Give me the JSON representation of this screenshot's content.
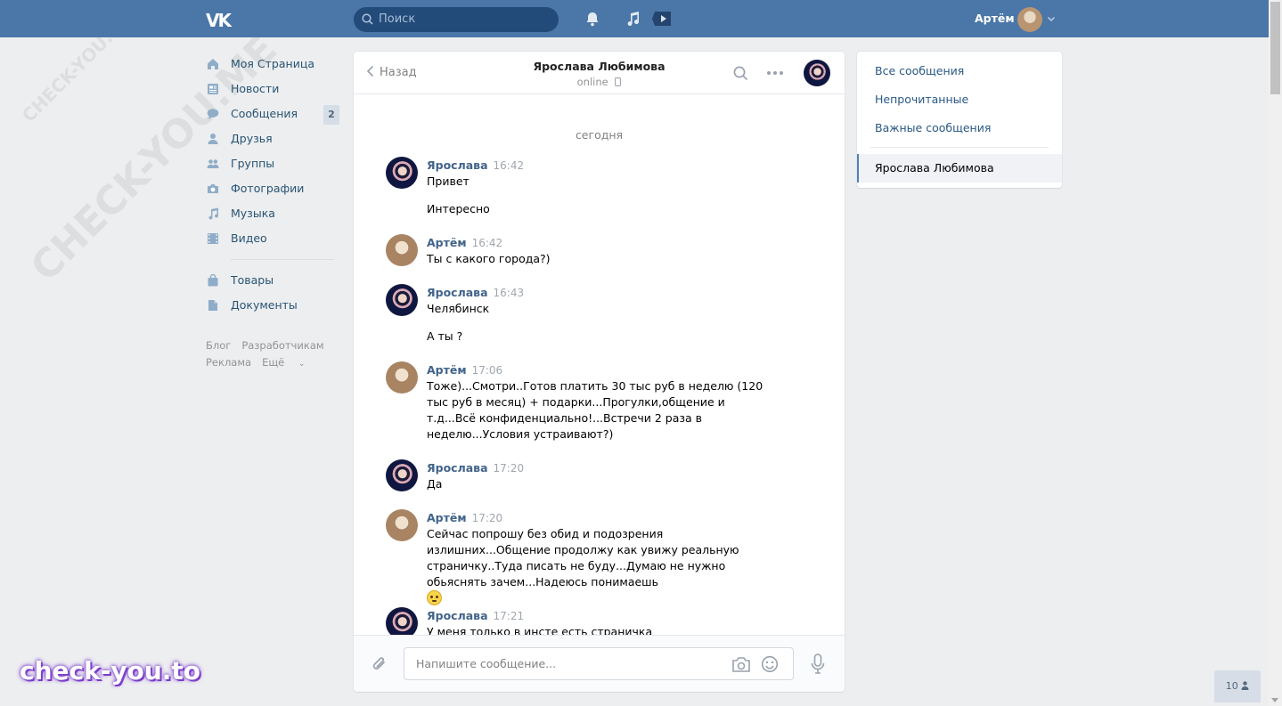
{
  "header": {
    "logo": "VK",
    "search_placeholder": "Поиск",
    "user_name": "Артём"
  },
  "nav": {
    "items": [
      {
        "label": "Моя Страница",
        "icon": "home-icon"
      },
      {
        "label": "Новости",
        "icon": "news-icon"
      },
      {
        "label": "Сообщения",
        "icon": "messages-icon",
        "badge": "2"
      },
      {
        "label": "Друзья",
        "icon": "friends-icon"
      },
      {
        "label": "Группы",
        "icon": "groups-icon"
      },
      {
        "label": "Фотографии",
        "icon": "camera-icon"
      },
      {
        "label": "Музыка",
        "icon": "music-icon"
      },
      {
        "label": "Видео",
        "icon": "video-icon"
      }
    ],
    "items2": [
      {
        "label": "Товары",
        "icon": "bag-icon"
      },
      {
        "label": "Документы",
        "icon": "document-icon"
      }
    ],
    "footer": {
      "blog": "Блог",
      "developers": "Разработчикам",
      "ads": "Реклама",
      "more": "Ещё"
    }
  },
  "chat": {
    "back_label": "Назад",
    "peer_name": "Ярослава Любимова",
    "peer_status": "online",
    "day_separator": "сегодня",
    "messages": [
      {
        "author": "Ярослава",
        "time": "16:42",
        "text": "Привет",
        "text2": "Интересно"
      },
      {
        "author": "Артём",
        "time": "16:42",
        "text": "Ты с какого города?)"
      },
      {
        "author": "Ярослава",
        "time": "16:43",
        "text": "Челябинск",
        "text2": "А ты ?"
      },
      {
        "author": "Артём",
        "time": "17:06",
        "text": "Тоже)...Смотри..Готов платить 30 тыс руб в неделю (120 тыс руб в месяц) + подарки...Прогулки,общение и т.д...Всё конфиденциально!...Встречи 2 раза в неделю...Условия устраивают?)"
      },
      {
        "author": "Ярослава",
        "time": "17:20",
        "text": "Да"
      },
      {
        "author": "Артём",
        "time": "17:20",
        "text": "Сейчас попрошу без обид и подозрения излишних...Общение продолжу как увижу реальную страничку..Туда писать не буду...Думаю не нужно обьяснять зачем...Надеюсь понимаешь"
      },
      {
        "author": "Ярослава",
        "time": "17:21",
        "text": "У меня только в инсте есть страничка"
      }
    ],
    "input_placeholder": "Напишите сообщение..."
  },
  "right_panel": {
    "all": "Все сообщения",
    "unread": "Непрочитанные",
    "important": "Важные сообщения",
    "active_conversation": "Ярослава Любимова"
  },
  "watermark": {
    "brand": "check-you.to",
    "diagonal": "CHECK-YOU.ME"
  },
  "online_widget": {
    "count": "10"
  },
  "colors": {
    "header": "#4a76a8",
    "link": "#2a5885",
    "background": "#edeef0"
  }
}
